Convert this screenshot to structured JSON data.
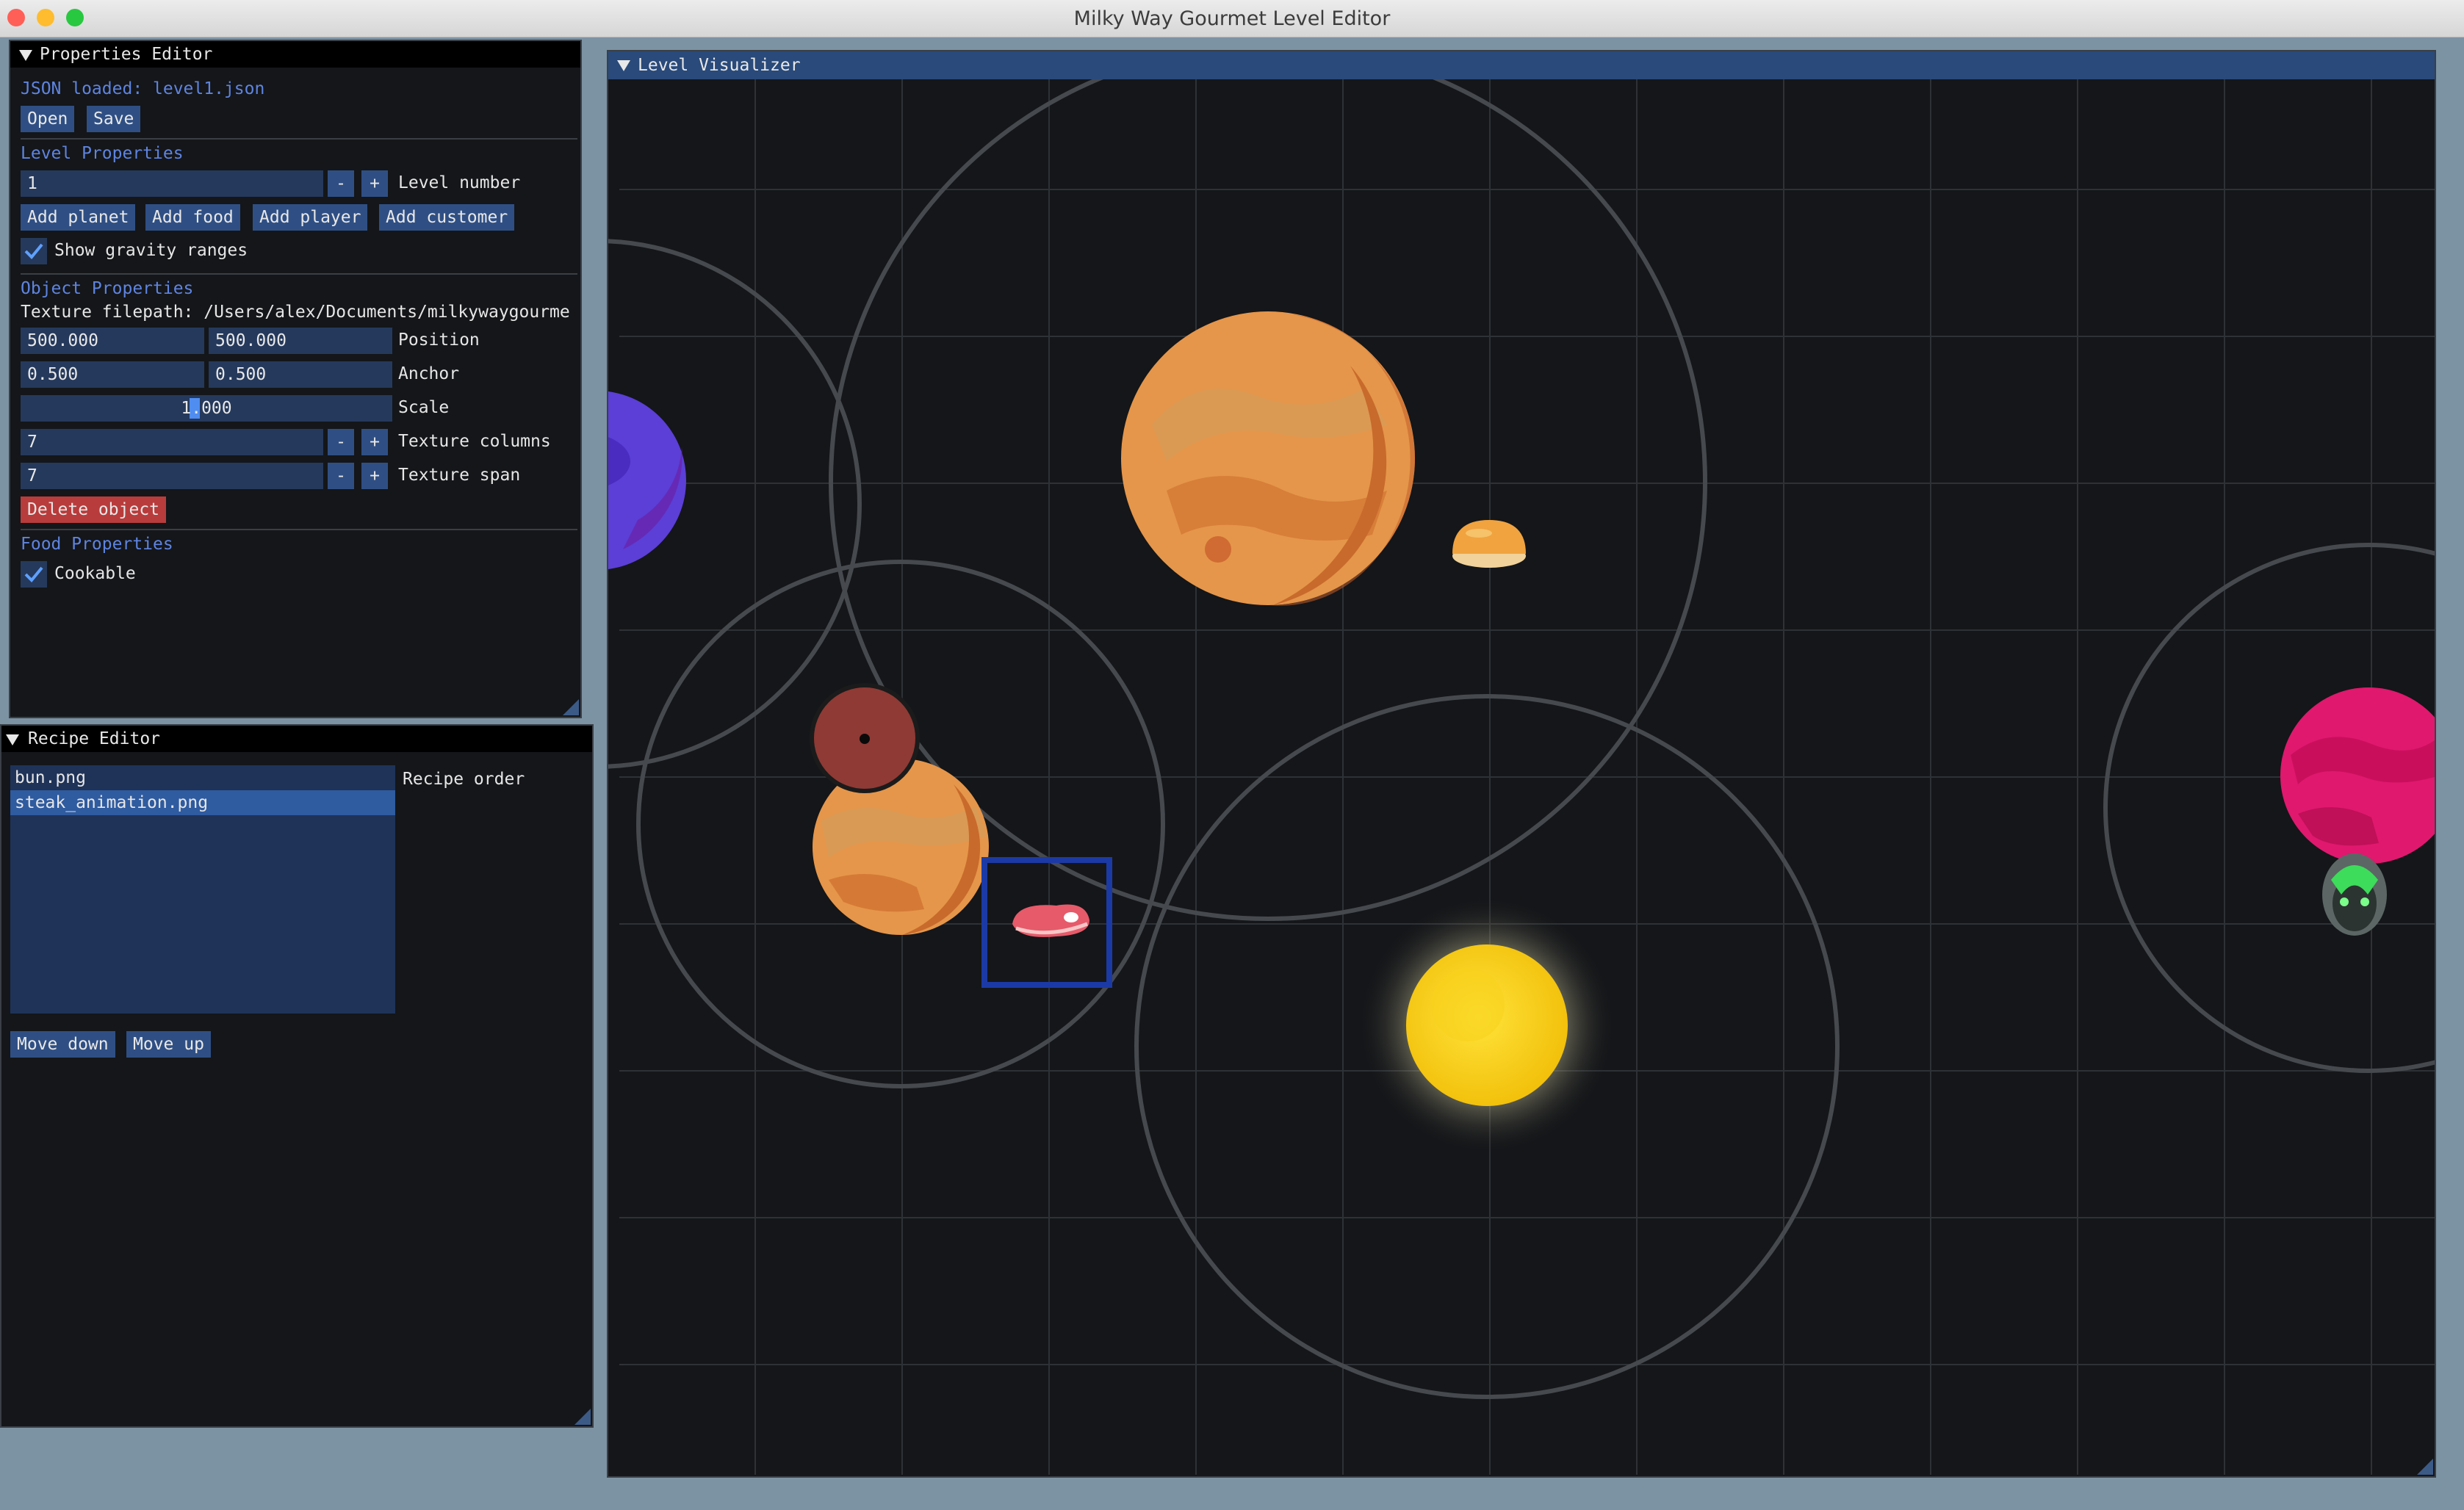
{
  "window": {
    "title": "Milky Way Gourmet Level Editor",
    "colors": {
      "close": "#ff5f57",
      "minimize": "#febc2e",
      "zoom": "#28c840"
    }
  },
  "properties_editor": {
    "title": "Properties Editor",
    "json_status": "JSON loaded: level1.json",
    "open_label": "Open",
    "save_label": "Save",
    "level_header": "Level Properties",
    "level_number_value": "1",
    "level_number_label": "Level number",
    "minus_label": "-",
    "plus_label": "+",
    "add_planet_label": "Add planet",
    "add_food_label": "Add food",
    "add_player_label": "Add player",
    "add_customer_label": "Add customer",
    "show_gravity_label": "Show gravity ranges",
    "show_gravity_checked": true,
    "object_header": "Object Properties",
    "texture_filepath": "Texture filepath: /Users/alex/Documents/milkywaygourme",
    "position_x": "500.000",
    "position_y": "500.000",
    "position_label": "Position",
    "anchor_x": "0.500",
    "anchor_y": "0.500",
    "anchor_label": "Anchor",
    "scale_value": "1.000",
    "scale_label": "Scale",
    "texture_columns_value": "7",
    "texture_columns_label": "Texture columns",
    "texture_span_value": "7",
    "texture_span_label": "Texture span",
    "delete_label": "Delete object",
    "food_header": "Food Properties",
    "cookable_label": "Cookable",
    "cookable_checked": true
  },
  "recipe_editor": {
    "title": "Recipe Editor",
    "items": [
      "bun.png",
      "steak_animation.png"
    ],
    "selected_index": 1,
    "order_label": "Recipe order",
    "move_down_label": "Move down",
    "move_up_label": "Move up"
  },
  "level_visualizer": {
    "title": "Level Visualizer",
    "objects": [
      "blue-planet",
      "orange-planet-large",
      "bun",
      "red-planet-small",
      "orange-planet-small",
      "steak",
      "sun",
      "pink-planet",
      "customer-alien"
    ],
    "selected_object": "steak",
    "accent_color": "#1e3a8a"
  }
}
